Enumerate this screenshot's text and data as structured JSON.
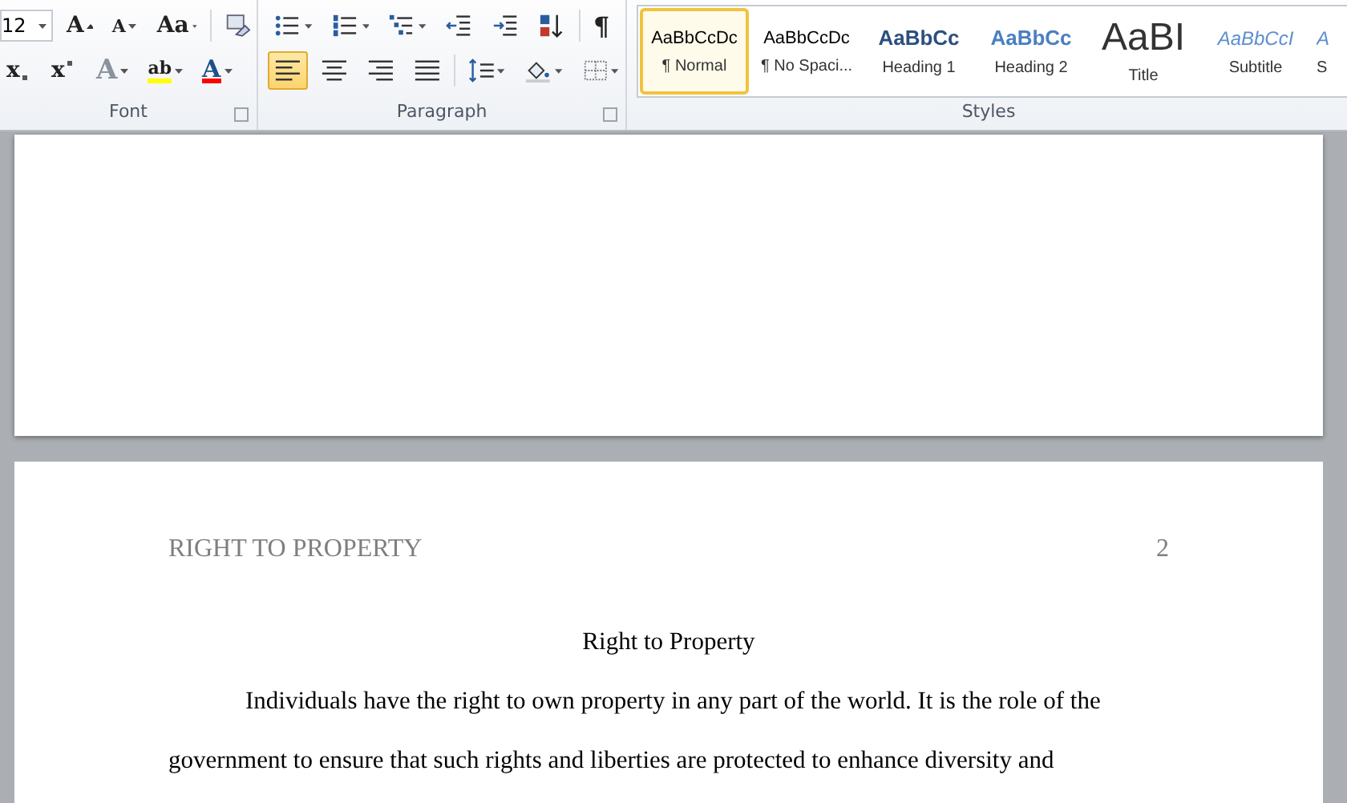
{
  "ribbon": {
    "font_group": {
      "label": "Font",
      "font_size": "12",
      "row1": [
        {
          "kind": "grow",
          "glyph": "A"
        },
        {
          "kind": "shrink",
          "glyph": "A"
        },
        {
          "kind": "case",
          "glyph": "Aa"
        }
      ],
      "row2": [
        {
          "kind": "subscript",
          "glyph": "x"
        },
        {
          "kind": "superscript",
          "glyph": "x"
        },
        {
          "kind": "effects",
          "glyph": "A"
        },
        {
          "kind": "highlight",
          "glyph": "ab"
        },
        {
          "kind": "fontcolor",
          "glyph": "A"
        }
      ]
    },
    "paragraph_group": {
      "label": "Paragraph",
      "show_marks": "¶",
      "row1": [
        {
          "kind": "bullets"
        },
        {
          "kind": "numbering"
        },
        {
          "kind": "multilevel"
        },
        {
          "kind": "outdent"
        },
        {
          "kind": "indent"
        },
        {
          "kind": "sort"
        }
      ],
      "align": [
        {
          "kind": "left",
          "selected": true
        },
        {
          "kind": "center",
          "selected": false
        },
        {
          "kind": "right",
          "selected": false
        },
        {
          "kind": "justify",
          "selected": false
        }
      ],
      "row2": [
        {
          "kind": "linespacing"
        },
        {
          "kind": "shading"
        },
        {
          "kind": "borders"
        }
      ]
    },
    "styles_group": {
      "label": "Styles",
      "items": [
        {
          "kind": "normal",
          "preview": "AaBbCcDc",
          "name": "¶ Normal",
          "selected": true
        },
        {
          "kind": "normal",
          "preview": "AaBbCcDc",
          "name": "¶ No Spaci...",
          "selected": false
        },
        {
          "kind": "heading1",
          "preview": "AaBbCc",
          "name": "Heading 1",
          "selected": false
        },
        {
          "kind": "heading2",
          "preview": "AaBbCc",
          "name": "Heading 2",
          "selected": false
        },
        {
          "kind": "title",
          "preview": "AaBI",
          "name": "Title",
          "selected": false
        },
        {
          "kind": "subtitle",
          "preview": "AaBbCcI",
          "name": "Subtitle",
          "selected": false
        },
        {
          "kind": "subtitle",
          "preview": "A",
          "name": "S",
          "selected": false
        }
      ]
    }
  },
  "document": {
    "header": "RIGHT TO PROPERTY",
    "page_number": "2",
    "title": "Right to Property",
    "paragraph": "Individuals have the right to own property in any part of the world. It is the role of the government to ensure that such rights and liberties are protected to enhance diversity and"
  }
}
